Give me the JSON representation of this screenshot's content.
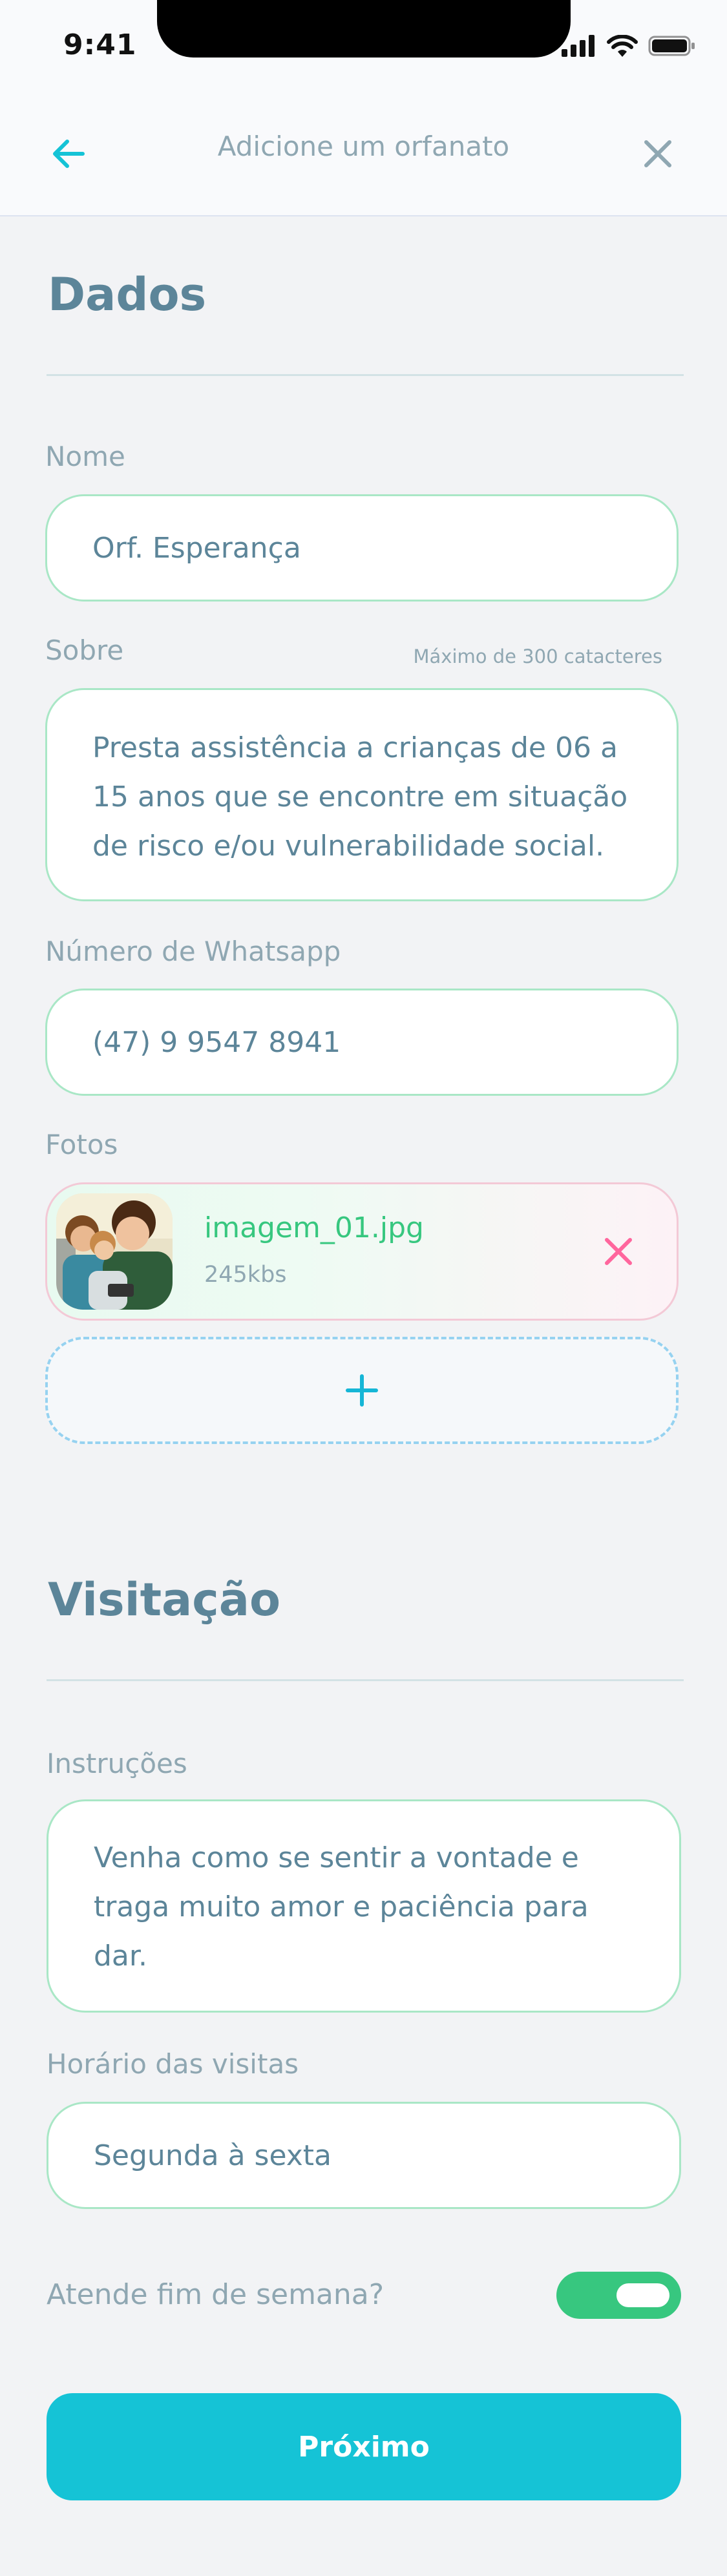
{
  "status_bar": {
    "time": "9:41"
  },
  "header": {
    "title": "Adicione um orfanato"
  },
  "dados": {
    "title": "Dados",
    "nome": {
      "label": "Nome",
      "value": "Orf. Esperança"
    },
    "sobre": {
      "label": "Sobre",
      "hint": "Máximo de 300 catacteres",
      "value": "Presta assistência a crianças de 06 a 15 anos que se encontre em situação de risco e/ou vulnerabilidade social."
    },
    "whatsapp": {
      "label": "Número de Whatsapp",
      "value": "(47) 9 9547 8941"
    },
    "fotos": {
      "label": "Fotos",
      "items": [
        {
          "name": "imagem_01.jpg",
          "size": "245kbs"
        }
      ]
    }
  },
  "visitacao": {
    "title": "Visitação",
    "instrucoes": {
      "label": "Instruções",
      "value": "Venha como se sentir a vontade e traga muito amor e paciência para dar."
    },
    "horario": {
      "label": "Horário das visitas",
      "value": "Segunda à sexta"
    },
    "fim_de_semana": {
      "label": "Atende fim de semana?",
      "enabled": true
    }
  },
  "actions": {
    "next_label": "Próximo"
  },
  "colors": {
    "primary": "#15c3d6",
    "success": "#37c77f",
    "danger": "#ff669d",
    "text": "#5c8599",
    "muted": "#8fa7b2"
  },
  "icons": {
    "back": "arrow-left-icon",
    "close": "close-icon",
    "remove_photo": "close-icon",
    "add_photo": "plus-icon"
  }
}
